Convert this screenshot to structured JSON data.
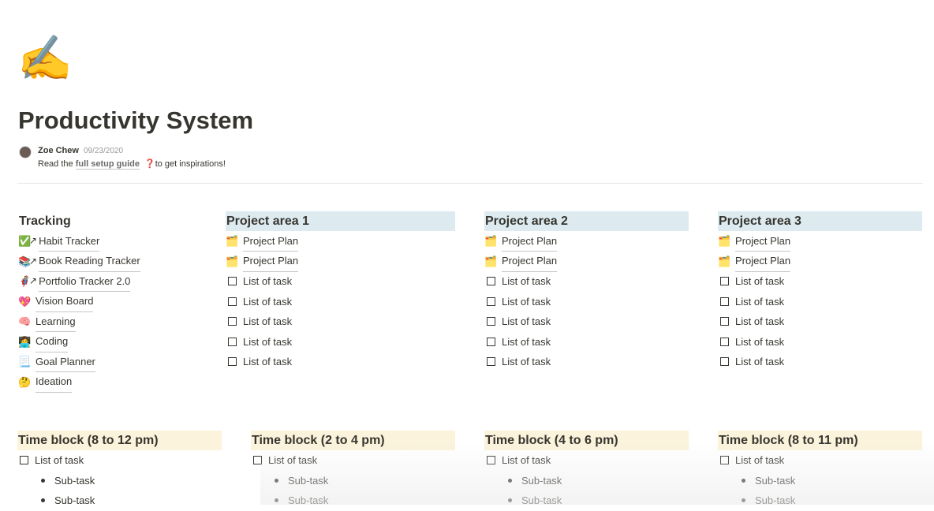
{
  "page": {
    "icon": "✍️",
    "title": "Productivity System"
  },
  "author": {
    "name": "Zoe Chew",
    "date": "09/23/2020",
    "desc_prefix": "Read the ",
    "desc_link": "full setup guide",
    "desc_icon": "❓",
    "desc_suffix": "to get inspirations!"
  },
  "tracking": {
    "heading": "Tracking",
    "items": [
      {
        "icon": "✅",
        "arrow": "↗",
        "label": "Habit Tracker"
      },
      {
        "icon": "📚",
        "arrow": "↗",
        "label": "Book Reading Tracker"
      },
      {
        "icon": "🦸",
        "arrow": "↗",
        "label": "Portfolio Tracker 2.0"
      },
      {
        "icon": "💖",
        "arrow": "",
        "label": "Vision Board"
      },
      {
        "icon": "🧠",
        "arrow": "",
        "label": "Learning"
      },
      {
        "icon": "👩‍💻",
        "arrow": "",
        "label": "Coding"
      },
      {
        "icon": "📃",
        "arrow": "",
        "label": "Goal Planner"
      },
      {
        "icon": "🤔",
        "arrow": "",
        "label": "Ideation"
      }
    ]
  },
  "projects": [
    {
      "heading": "Project area 1",
      "plans": [
        "Project Plan",
        "Project Plan"
      ],
      "tasks": [
        "List of task",
        "List of task",
        "List of task",
        "List of task",
        "List of task"
      ]
    },
    {
      "heading": "Project area 2",
      "plans": [
        "Project Plan",
        "Project Plan"
      ],
      "tasks": [
        "List of task",
        "List of task",
        "List of task",
        "List of task",
        "List of task"
      ]
    },
    {
      "heading": "Project area 3",
      "plans": [
        "Project Plan",
        "Project Plan"
      ],
      "tasks": [
        "List of task",
        "List of task",
        "List of task",
        "List of task",
        "List of task"
      ]
    }
  ],
  "plan_icon": "🗂️",
  "timeblocks": [
    {
      "heading": "Time block (8 to 12 pm)",
      "task": "List of task",
      "subtasks": [
        "Sub-task",
        "Sub-task"
      ]
    },
    {
      "heading": "Time block (2 to 4 pm)",
      "task": "List of task",
      "subtasks": [
        "Sub-task",
        "Sub-task"
      ]
    },
    {
      "heading": "Time block (4 to 6 pm)",
      "task": "List of task",
      "subtasks": [
        "Sub-task",
        "Sub-task"
      ]
    },
    {
      "heading": "Time block (8 to 11 pm)",
      "task": "List of task",
      "subtasks": [
        "Sub-task",
        "Sub-task"
      ]
    }
  ]
}
